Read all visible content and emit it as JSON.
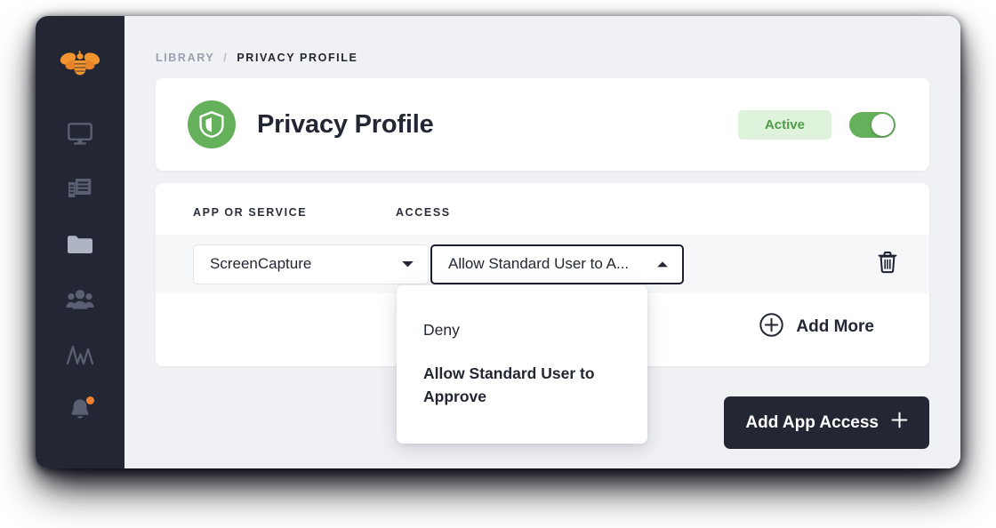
{
  "sidebar": {
    "brand": {
      "icon": "bee-logo-icon",
      "color": "#f2952e"
    },
    "items": [
      {
        "icon": "monitor-icon",
        "name": "devices"
      },
      {
        "icon": "documents-icon",
        "name": "reports"
      },
      {
        "icon": "folder-icon",
        "name": "library",
        "active": true
      },
      {
        "icon": "users-group-icon",
        "name": "users"
      },
      {
        "icon": "analytics-icon",
        "name": "analytics"
      },
      {
        "icon": "bell-icon",
        "name": "notifications",
        "badge": true
      }
    ]
  },
  "breadcrumb": {
    "root": "LIBRARY",
    "separator": "/",
    "current": "PRIVACY PROFILE"
  },
  "profile_header": {
    "icon": "shield-icon",
    "title": "Privacy Profile",
    "status_label": "Active",
    "status_enabled": true,
    "accent_green": "#64b05b",
    "badge_bg": "#dff2dc"
  },
  "access_table": {
    "columns": {
      "app": "APP OR SERVICE",
      "access": "ACCESS"
    },
    "rows": [
      {
        "app": "ScreenCapture",
        "access": "Allow Standard User to A...",
        "delete_icon": "trash-icon"
      }
    ],
    "add_more_label": "Add More",
    "add_more_icon": "plus-circle-icon"
  },
  "access_dropdown": {
    "open": true,
    "options": [
      {
        "label": "Deny",
        "selected": false
      },
      {
        "label": "Allow Standard User to Approve",
        "selected": true
      }
    ]
  },
  "footer": {
    "add_app_access_label": "Add App Access",
    "add_app_access_icon": "plus-icon"
  }
}
